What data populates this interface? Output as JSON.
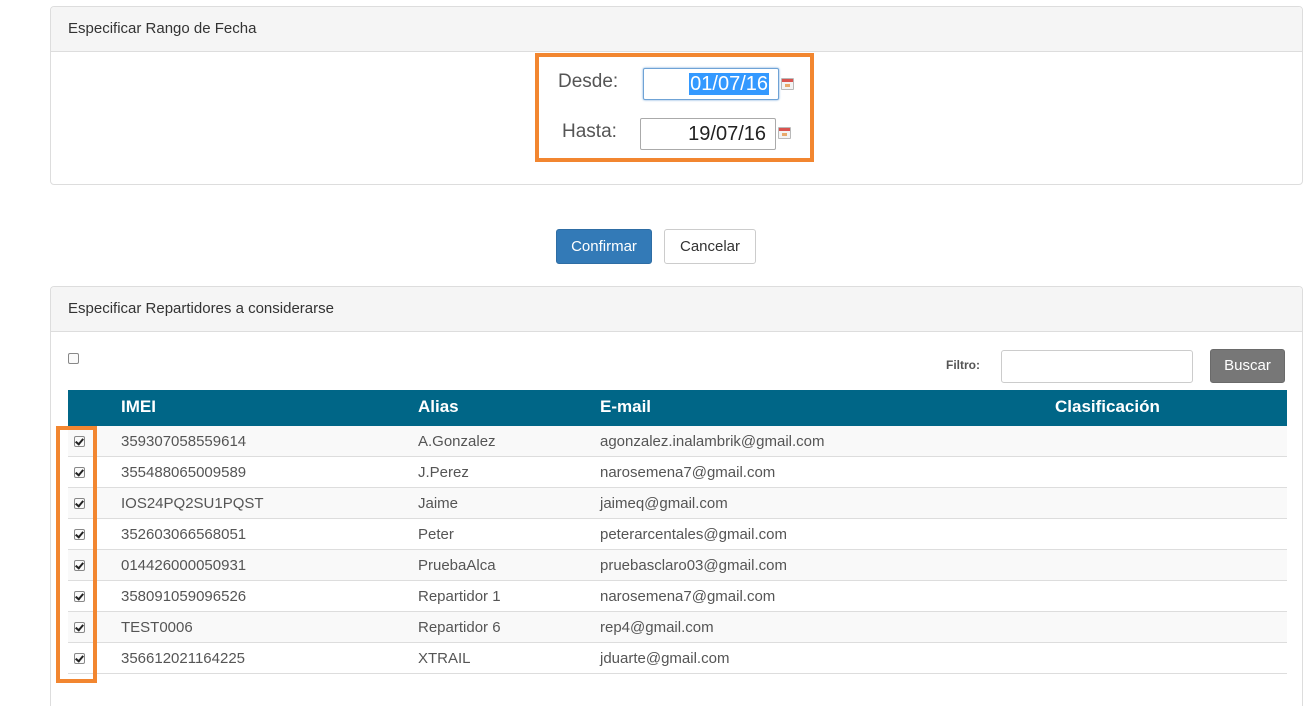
{
  "panel_fechas": {
    "title": "Especificar Rango de Fecha",
    "desde_label": "Desde:",
    "desde_value": "01/07/16",
    "hasta_label": "Hasta:",
    "hasta_value": "19/07/16"
  },
  "actions": {
    "confirm_label": "Confirmar",
    "cancel_label": "Cancelar"
  },
  "panel_repartidores": {
    "title": "Especificar Repartidores a considerarse",
    "select_all_checked": false,
    "filter_label": "Filtro:",
    "filter_value": "",
    "search_label": "Buscar",
    "columns": [
      "IMEI",
      "Alias",
      "E-mail",
      "Clasificación"
    ],
    "rows": [
      {
        "imei": "359307058559614",
        "alias": "A.Gonzalez",
        "email": "agonzalez.inalambrik@gmail.com",
        "clasificacion": "",
        "checked": true
      },
      {
        "imei": "355488065009589",
        "alias": "J.Perez",
        "email": "narosemena7@gmail.com",
        "clasificacion": "",
        "checked": true
      },
      {
        "imei": "IOS24PQ2SU1PQST",
        "alias": "Jaime",
        "email": "jaimeq@gmail.com",
        "clasificacion": "",
        "checked": true
      },
      {
        "imei": "352603066568051",
        "alias": "Peter",
        "email": "peterarcentales@gmail.com",
        "clasificacion": "",
        "checked": true
      },
      {
        "imei": "014426000050931",
        "alias": "PruebaAlca",
        "email": "pruebasclaro03@gmail.com",
        "clasificacion": "",
        "checked": true
      },
      {
        "imei": "358091059096526",
        "alias": "Repartidor 1",
        "email": "narosemena7@gmail.com",
        "clasificacion": "",
        "checked": true
      },
      {
        "imei": "TEST0006",
        "alias": "Repartidor 6",
        "email": "rep4@gmail.com",
        "clasificacion": "",
        "checked": true
      },
      {
        "imei": "356612021164225",
        "alias": "XTRAIL",
        "email": "jduarte@gmail.com",
        "clasificacion": "",
        "checked": true
      }
    ]
  },
  "colors": {
    "primary_button": "#337ab7",
    "table_header": "#006687",
    "highlight": "#f28630",
    "search_button": "#777777"
  },
  "icons": {
    "calendar": "calendar-icon",
    "checkbox": "checkbox-icon"
  }
}
